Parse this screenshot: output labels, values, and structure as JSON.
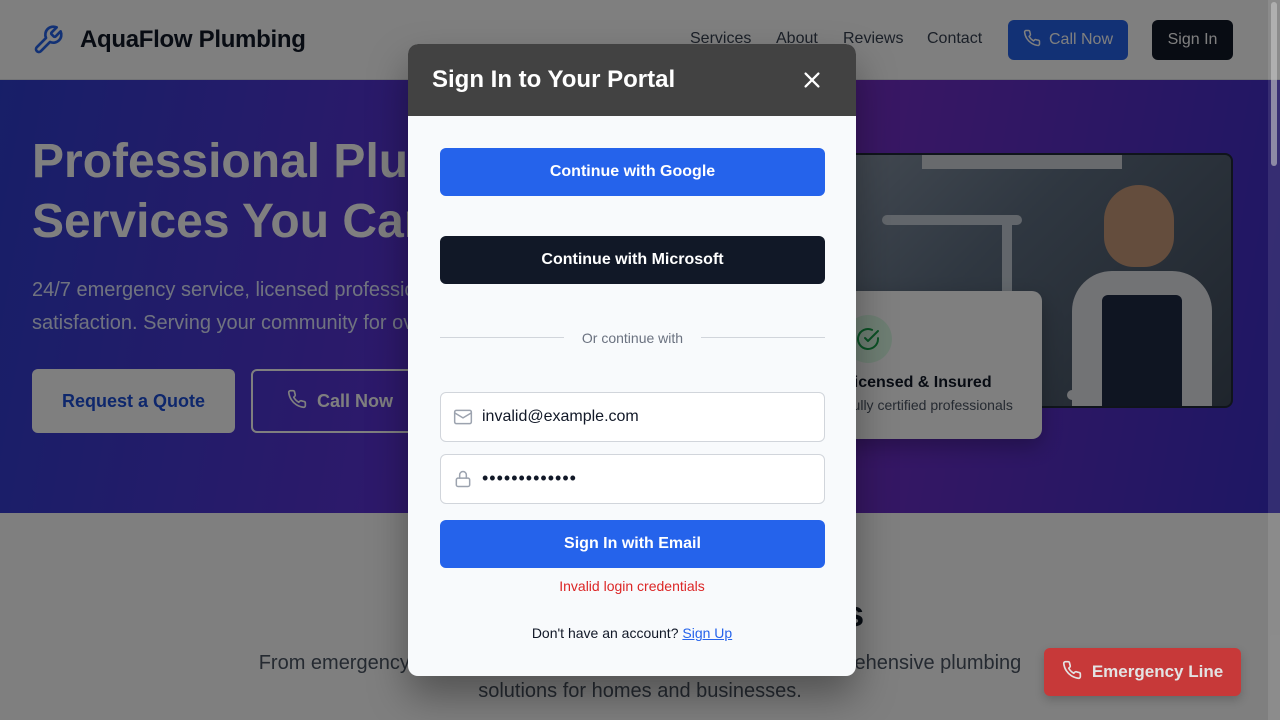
{
  "header": {
    "brand": "AquaFlow Plumbing",
    "nav": [
      "Services",
      "About",
      "Reviews",
      "Contact"
    ],
    "call_label": "Call Now",
    "signin_label": "Sign In"
  },
  "hero": {
    "title_line1": "Professional Plumbing",
    "title_line2": "Services You Can Trust",
    "subtitle_line1": "24/7 emergency service, licensed professionals, and guaranteed",
    "subtitle_line2": "satisfaction. Serving your community for over 20 years.",
    "quote_label": "Request a Quote",
    "call_label": "Call Now",
    "badge_title": "Licensed & Insured",
    "badge_subtitle": "Fully certified professionals"
  },
  "services": {
    "title": "Our Professional Services",
    "subtitle": "From emergency repairs to routine maintenance, we provide comprehensive plumbing solutions for homes and businesses."
  },
  "emergency": {
    "label": "Emergency Line"
  },
  "modal": {
    "title": "Sign In to Your Portal",
    "google_label": "Continue with Google",
    "microsoft_label": "Continue with Microsoft",
    "divider": "Or continue with",
    "email_value": "invalid@example.com",
    "password_mask": "•••••••••••••",
    "submit_label": "Sign In with Email",
    "error": "Invalid login credentials",
    "signup_prompt": "Don't have an account?",
    "signup_link": "Sign Up"
  },
  "colors": {
    "primary": "#2563eb",
    "dark": "#111827",
    "danger": "#dc2626",
    "modal_header": "#424242"
  },
  "icons": [
    "wrench-icon",
    "phone-icon",
    "check-circle-icon",
    "close-icon",
    "mail-icon",
    "lock-icon"
  ]
}
